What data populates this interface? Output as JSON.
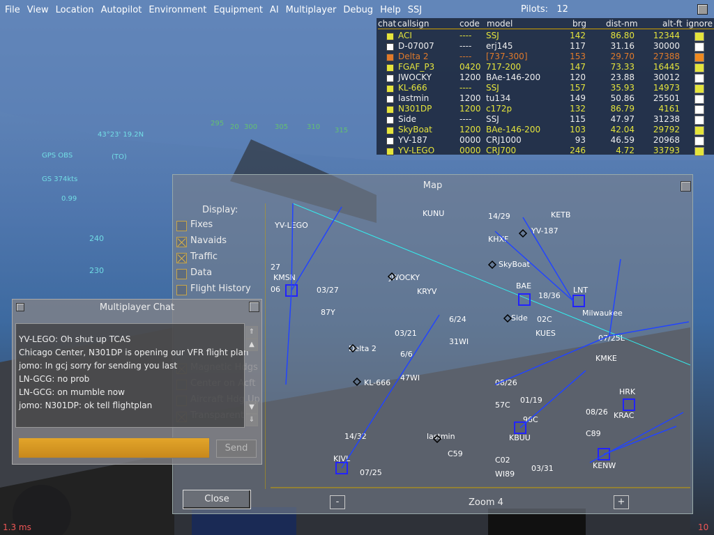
{
  "menu": [
    "File",
    "View",
    "Location",
    "Autopilot",
    "Environment",
    "Equipment",
    "AI",
    "Multiplayer",
    "Debug",
    "Help",
    "SSJ"
  ],
  "pilots": {
    "label": "Pilots:",
    "count": "12"
  },
  "pilot_list": {
    "headers": {
      "chat": "chat",
      "callsign": "callsign",
      "code": "code",
      "model": "model",
      "brg": "brg",
      "dist": "dist-nm",
      "alt": "alt-ft",
      "ignore": "ignore"
    },
    "rows": [
      {
        "callsign": "ACI",
        "code": "----",
        "model": "SSJ",
        "brg": "142",
        "dist": "86.80",
        "alt": "12344",
        "color": "#e4e43c",
        "chk": "#e4e43c",
        "ign": "#e4e43c"
      },
      {
        "callsign": "D-07007",
        "code": "----",
        "model": "erj145",
        "brg": "117",
        "dist": "31.16",
        "alt": "30000",
        "color": "#eeeeee",
        "chk": "#ffffff",
        "ign": "#ffffff"
      },
      {
        "callsign": "Delta 2",
        "code": "----",
        "model": "[737-300]",
        "brg": "153",
        "dist": "29.70",
        "alt": "27388",
        "color": "#e07a2a",
        "chk": "#e07a2a",
        "ign": "#f08a20"
      },
      {
        "callsign": "FGAF_P3",
        "code": "0420",
        "model": "717-200",
        "brg": "147",
        "dist": "73.33",
        "alt": "16445",
        "color": "#e4e43c",
        "chk": "#e4e43c",
        "ign": "#e4e43c"
      },
      {
        "callsign": "JWOCKY",
        "code": "1200",
        "model": "BAe-146-200",
        "brg": "120",
        "dist": "23.88",
        "alt": "30012",
        "color": "#eeeeee",
        "chk": "#ffffff",
        "ign": "#ffffff"
      },
      {
        "callsign": "KL-666",
        "code": "----",
        "model": "SSJ",
        "brg": "157",
        "dist": "35.93",
        "alt": "14973",
        "color": "#e4e43c",
        "chk": "#e4e43c",
        "ign": "#e4e43c"
      },
      {
        "callsign": "lastmin",
        "code": "1200",
        "model": "tu134",
        "brg": "149",
        "dist": "50.86",
        "alt": "25501",
        "color": "#eeeeee",
        "chk": "#ffffff",
        "ign": "#ffffff"
      },
      {
        "callsign": "N301DP",
        "code": "1200",
        "model": "c172p",
        "brg": "132",
        "dist": "86.79",
        "alt": "4161",
        "color": "#e4e43c",
        "chk": "#e4e43c",
        "ign": "#ffffff"
      },
      {
        "callsign": "Side",
        "code": "----",
        "model": "SSJ",
        "brg": "115",
        "dist": "47.97",
        "alt": "31238",
        "color": "#eeeeee",
        "chk": "#ffffff",
        "ign": "#ffffff"
      },
      {
        "callsign": "SkyBoat",
        "code": "1200",
        "model": "BAe-146-200",
        "brg": "103",
        "dist": "42.04",
        "alt": "29792",
        "color": "#e4e43c",
        "chk": "#e4e43c",
        "ign": "#e4e43c"
      },
      {
        "callsign": "YV-187",
        "code": "0000",
        "model": "CRJ1000",
        "brg": "93",
        "dist": "46.59",
        "alt": "20968",
        "color": "#eeeeee",
        "chk": "#ffffff",
        "ign": "#ffffff"
      },
      {
        "callsign": "YV-LEGO",
        "code": "0000",
        "model": "CRJ700",
        "brg": "246",
        "dist": "4.72",
        "alt": "33793",
        "color": "#e4e43c",
        "chk": "#e4e43c",
        "ign": "#e4e43c"
      }
    ]
  },
  "map": {
    "title": "Map",
    "display_label": "Display:",
    "options": [
      {
        "label": "Fixes",
        "checked": false
      },
      {
        "label": "Navaids",
        "checked": true
      },
      {
        "label": "Traffic",
        "checked": true
      },
      {
        "label": "Data",
        "checked": false
      },
      {
        "label": "Flight History",
        "checked": false
      },
      {
        "label": "Magnetic Hdgs",
        "checked": true
      },
      {
        "label": "Center on Acft",
        "checked": false
      },
      {
        "label": "Aircraft Hdg Up",
        "checked": false
      },
      {
        "label": "Transparent",
        "checked": true
      }
    ],
    "zoom_label": "Zoom 4",
    "zoom_out": "-",
    "zoom_in": "+",
    "close_label": "Close",
    "labels": [
      "YV-LEGO",
      "KUNU",
      "14/29",
      "KETB",
      "KHXF",
      "YV-187",
      "SkyBoat",
      "KMSN",
      "03/27",
      "87Y",
      "JWOCKY",
      "KRYV",
      "BAE",
      "LNT",
      "18/36",
      "02C",
      "Side",
      "KUES",
      "Milwaukee",
      "03/21",
      "6/24",
      "31WI",
      "07/25L",
      "KMKE",
      "Delta 2",
      "6/6",
      "47WI",
      "KL-666",
      "08/26",
      "57C",
      "01/19",
      "96C",
      "HRK",
      "KRAC",
      "08/26",
      "C89",
      "lastmin",
      "KBUU",
      "14/32",
      "C59",
      "C02",
      "KJVL",
      "07/25",
      "WI89",
      "03/31",
      "KENW",
      "27",
      "06"
    ]
  },
  "chat": {
    "title": "Multiplayer Chat",
    "messages": [
      "YV-LEGO: Oh shut up TCAS",
      "Chicago Center, N301DP is opening our VFR flight plan",
      "jomo: In gcj sorry for sending you last",
      "LN-GCG: no prob",
      "LN-GCG: on mumble now",
      "jomo: N301DP: ok tell flightplan"
    ],
    "send_label": "Send"
  },
  "hud": {
    "position": "43°23' 19.2N",
    "gps": "GPS OBS",
    "to": "(TO)",
    "gs": "GS 374kts",
    "heading_scale": [
      "295",
      "20",
      "300",
      "305",
      "310",
      "315"
    ],
    "alt_marks": [
      "240",
      "230"
    ],
    "mach": "0.99"
  },
  "status": {
    "fps": "1.3 ms",
    "right": "10"
  }
}
